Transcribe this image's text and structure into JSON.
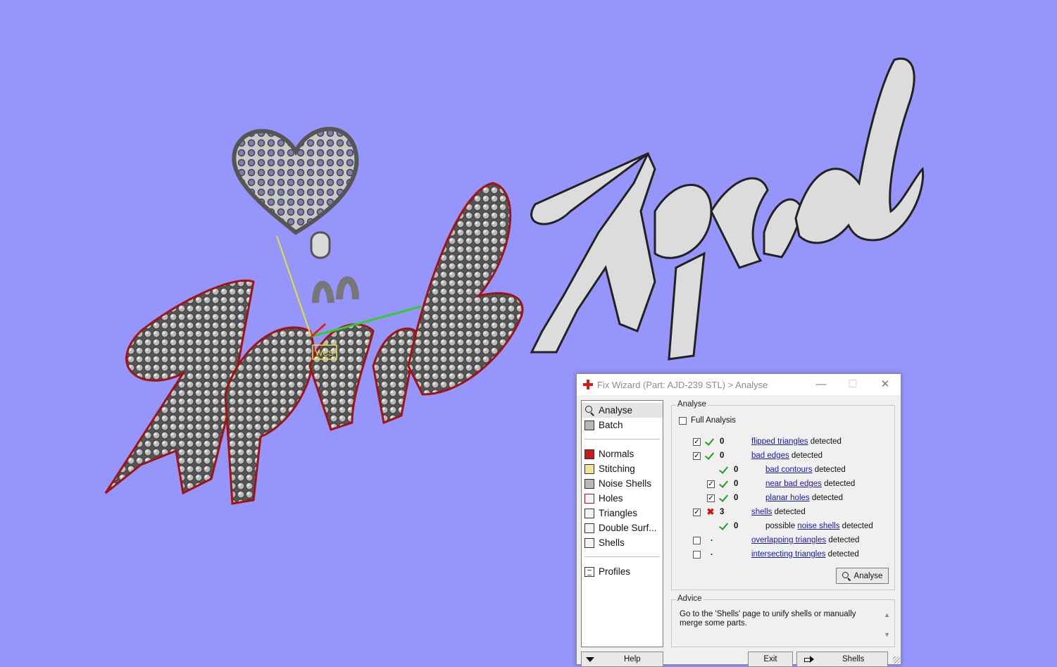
{
  "colors": {
    "viewport_bg": "#9595fb",
    "check_green": "#20a020",
    "error_red": "#d01010",
    "link_blue": "#1b1b9e"
  },
  "viewport": {
    "origin_label": "WCS"
  },
  "dialog": {
    "title": "Fix Wizard (Part: AJD-239 STL) > Analyse",
    "sidebar": {
      "top_items": [
        {
          "label": "Analyse",
          "icon": "magnifier-icon",
          "selected": true
        },
        {
          "label": "Batch",
          "icon": "batch-icon"
        }
      ],
      "fix_items": [
        {
          "label": "Normals",
          "icon": "normals-icon"
        },
        {
          "label": "Stitching",
          "icon": "stitching-icon"
        },
        {
          "label": "Noise Shells",
          "icon": "noise-shells-icon"
        },
        {
          "label": "Holes",
          "icon": "holes-icon"
        },
        {
          "label": "Triangles",
          "icon": "triangles-icon"
        },
        {
          "label": "Double Surf...",
          "icon": "double-surfaces-icon"
        },
        {
          "label": "Shells",
          "icon": "shells-icon"
        }
      ],
      "bottom_items": [
        {
          "label": "Profiles",
          "icon": "profiles-icon"
        }
      ]
    },
    "analyse": {
      "group_label": "Analyse",
      "full_analysis_label": "Full Analysis",
      "rows": {
        "flipped": {
          "count": "0",
          "prefix": "",
          "link": "flipped triangles",
          "suffix": " detected"
        },
        "bad_edges": {
          "count": "0",
          "prefix": "",
          "link": "bad edges",
          "suffix": " detected"
        },
        "bad_contours": {
          "count": "0",
          "prefix": "",
          "link": "bad contours",
          "suffix": " detected"
        },
        "near_bad_edges": {
          "count": "0",
          "prefix": "",
          "link": "near bad edges",
          "suffix": " detected"
        },
        "planar_holes": {
          "count": "0",
          "prefix": "",
          "link": "planar holes",
          "suffix": " detected"
        },
        "shells": {
          "count": "3",
          "prefix": "",
          "link": "shells",
          "suffix": " detected"
        },
        "noise_shells": {
          "count": "0",
          "prefix": "possible ",
          "link": "noise shells",
          "suffix": " detected"
        },
        "overlapping": {
          "count": ".",
          "prefix": "",
          "link": "overlapping triangles",
          "suffix": " detected"
        },
        "intersecting": {
          "count": ".",
          "prefix": "",
          "link": "intersecting triangles",
          "suffix": " detected"
        }
      },
      "button_label": "Analyse"
    },
    "advice": {
      "group_label": "Advice",
      "text": "Go to the 'Shells' page to unify shells or manually merge some parts."
    },
    "buttons": {
      "help": "Help",
      "exit": "Exit",
      "shells": "Shells"
    }
  }
}
